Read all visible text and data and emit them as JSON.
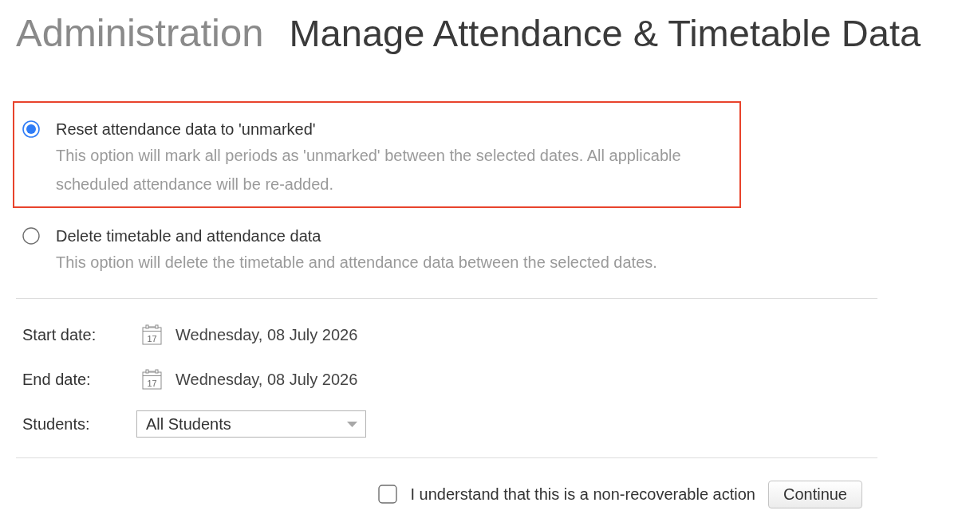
{
  "header": {
    "section": "Administration",
    "title": "Manage Attendance & Timetable Data"
  },
  "options": [
    {
      "label": "Reset attendance data to 'unmarked'",
      "description": "This option will mark all periods as 'unmarked' between the selected dates. All applicable scheduled attendance will be re-added.",
      "selected": true,
      "highlighted": true
    },
    {
      "label": "Delete timetable and attendance data",
      "description": "This option will delete the timetable and attendance data between the selected dates.",
      "selected": false,
      "highlighted": false
    }
  ],
  "fields": [
    {
      "kind": "date",
      "label": "Start date:",
      "value": "Wednesday, 08 July 2026",
      "icon_text": "17"
    },
    {
      "kind": "date",
      "label": "End date:",
      "value": "Wednesday, 08 July 2026",
      "icon_text": "17"
    },
    {
      "kind": "select",
      "label": "Students:",
      "value": "All Students"
    }
  ],
  "confirmation": {
    "label": "I understand that this is a non-recoverable action",
    "checked": false
  },
  "buttons": [
    "Continue"
  ]
}
